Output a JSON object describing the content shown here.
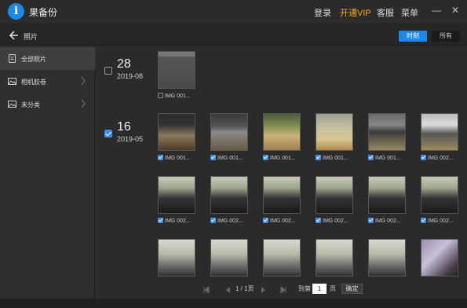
{
  "app": {
    "logo_letter": "i",
    "name": "果备份"
  },
  "top_menu": {
    "login": "登录",
    "vip": "开通VIP",
    "service": "客服",
    "menu": "菜单"
  },
  "window": {
    "minimize": "—",
    "close": "✕"
  },
  "header": {
    "title": "照片",
    "view_time": "时刻",
    "view_all": "所有"
  },
  "sidebar": {
    "items": [
      {
        "label": "全部照片",
        "icon": "document-icon",
        "active": true
      },
      {
        "label": "相机胶卷",
        "icon": "image-icon",
        "active": false
      },
      {
        "label": "未分类",
        "icon": "image-icon",
        "active": false
      }
    ]
  },
  "groups": [
    {
      "day": "28",
      "month": "2019-08",
      "checked": false,
      "photos": [
        {
          "label": "IMG 001...",
          "checked": false,
          "scene": "dark"
        }
      ]
    },
    {
      "day": "16",
      "month": "2019-05",
      "checked": true,
      "photos": [
        {
          "label": "IMG 001...",
          "checked": true,
          "scene": "monitor"
        },
        {
          "label": "IMG 001...",
          "checked": true,
          "scene": "office"
        },
        {
          "label": "IMG 001...",
          "checked": true,
          "scene": "plant"
        },
        {
          "label": "IMG 001...",
          "checked": true,
          "scene": "desk"
        },
        {
          "label": "IMG 001...",
          "checked": true,
          "scene": "screen"
        },
        {
          "label": "IMG 002...",
          "checked": true,
          "scene": "screen2"
        },
        {
          "label": "IMG 002...",
          "checked": true,
          "scene": "chair"
        },
        {
          "label": "IMG 002...",
          "checked": true,
          "scene": "chair"
        },
        {
          "label": "IMG 002...",
          "checked": true,
          "scene": "chair"
        },
        {
          "label": "IMG 002...",
          "checked": true,
          "scene": "chair"
        },
        {
          "label": "IMG 002...",
          "checked": true,
          "scene": "chair"
        },
        {
          "label": "IMG 002...",
          "checked": true,
          "scene": "chair"
        },
        {
          "label": "",
          "checked": true,
          "scene": "bright"
        },
        {
          "label": "",
          "checked": true,
          "scene": "bright"
        },
        {
          "label": "",
          "checked": true,
          "scene": "bright"
        },
        {
          "label": "",
          "checked": true,
          "scene": "bright"
        },
        {
          "label": "",
          "checked": true,
          "scene": "bright"
        },
        {
          "label": "",
          "checked": true,
          "scene": "purple"
        }
      ]
    }
  ],
  "pager": {
    "current": "1 / 1页",
    "goto": "到第",
    "page_value": "1",
    "page_suffix": "页",
    "confirm": "确定"
  },
  "colors": {
    "accent": "#1e88e5",
    "vip": "#f5a623",
    "background": "#2b2b2b"
  }
}
